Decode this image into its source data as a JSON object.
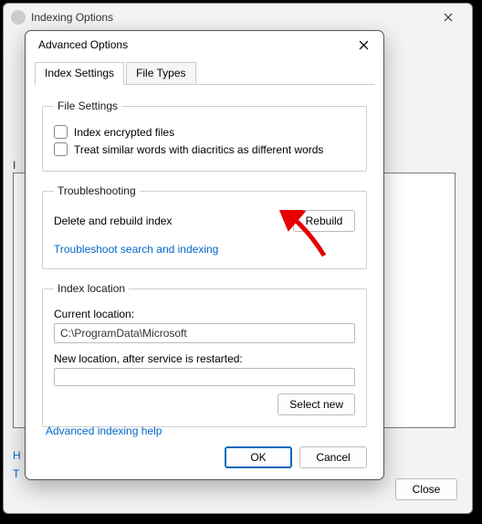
{
  "back": {
    "title": "Indexing Options",
    "list_label": "I",
    "h": "H",
    "t": "T",
    "close_btn": "Close"
  },
  "dialog": {
    "title": "Advanced Options",
    "tabs": {
      "settings": "Index Settings",
      "types": "File Types"
    },
    "file_settings": {
      "legend": "File Settings",
      "encrypted": "Index encrypted files",
      "diacritics": "Treat similar words with diacritics as different words"
    },
    "troubleshooting": {
      "legend": "Troubleshooting",
      "rebuild_text": "Delete and rebuild index",
      "rebuild_btn": "Rebuild",
      "link": "Troubleshoot search and indexing"
    },
    "location": {
      "legend": "Index location",
      "current_label": "Current location:",
      "current_value": "C:\\ProgramData\\Microsoft",
      "new_label": "New location, after service is restarted:",
      "new_value": "",
      "select_btn": "Select new"
    },
    "help_link": "Advanced indexing help",
    "ok": "OK",
    "cancel": "Cancel"
  }
}
